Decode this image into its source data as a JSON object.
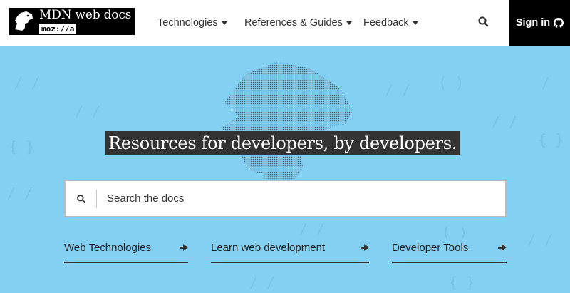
{
  "header": {
    "logo": {
      "title": "MDN web docs",
      "org": "moz://a",
      "icon": "dinosaur-icon"
    },
    "nav": [
      {
        "label": "Technologies"
      },
      {
        "label": "References & Guides"
      },
      {
        "label": "Feedback"
      }
    ],
    "search_icon": "search-icon",
    "signin": {
      "label": "Sign in",
      "icon": "github-icon"
    }
  },
  "hero": {
    "headline": "Resources for developers, by developers.",
    "search": {
      "placeholder": "Search the docs",
      "value": ""
    },
    "quicklinks": [
      {
        "label": "Web Technologies"
      },
      {
        "label": "Learn web development"
      },
      {
        "label": "Developer Tools"
      }
    ]
  },
  "colors": {
    "hero_background": "#83d0f2",
    "header_background": "#ffffff",
    "signin_background": "#000000",
    "headline_background": "#333333"
  }
}
